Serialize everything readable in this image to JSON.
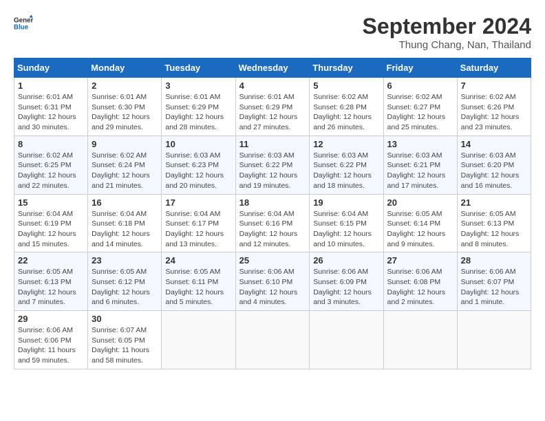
{
  "header": {
    "logo_line1": "General",
    "logo_line2": "Blue",
    "month": "September 2024",
    "location": "Thung Chang, Nan, Thailand"
  },
  "weekdays": [
    "Sunday",
    "Monday",
    "Tuesday",
    "Wednesday",
    "Thursday",
    "Friday",
    "Saturday"
  ],
  "weeks": [
    [
      {
        "day": "1",
        "sunrise": "6:01 AM",
        "sunset": "6:31 PM",
        "daylight": "12 hours and 30 minutes."
      },
      {
        "day": "2",
        "sunrise": "6:01 AM",
        "sunset": "6:30 PM",
        "daylight": "12 hours and 29 minutes."
      },
      {
        "day": "3",
        "sunrise": "6:01 AM",
        "sunset": "6:29 PM",
        "daylight": "12 hours and 28 minutes."
      },
      {
        "day": "4",
        "sunrise": "6:01 AM",
        "sunset": "6:29 PM",
        "daylight": "12 hours and 27 minutes."
      },
      {
        "day": "5",
        "sunrise": "6:02 AM",
        "sunset": "6:28 PM",
        "daylight": "12 hours and 26 minutes."
      },
      {
        "day": "6",
        "sunrise": "6:02 AM",
        "sunset": "6:27 PM",
        "daylight": "12 hours and 25 minutes."
      },
      {
        "day": "7",
        "sunrise": "6:02 AM",
        "sunset": "6:26 PM",
        "daylight": "12 hours and 23 minutes."
      }
    ],
    [
      {
        "day": "8",
        "sunrise": "6:02 AM",
        "sunset": "6:25 PM",
        "daylight": "12 hours and 22 minutes."
      },
      {
        "day": "9",
        "sunrise": "6:02 AM",
        "sunset": "6:24 PM",
        "daylight": "12 hours and 21 minutes."
      },
      {
        "day": "10",
        "sunrise": "6:03 AM",
        "sunset": "6:23 PM",
        "daylight": "12 hours and 20 minutes."
      },
      {
        "day": "11",
        "sunrise": "6:03 AM",
        "sunset": "6:22 PM",
        "daylight": "12 hours and 19 minutes."
      },
      {
        "day": "12",
        "sunrise": "6:03 AM",
        "sunset": "6:22 PM",
        "daylight": "12 hours and 18 minutes."
      },
      {
        "day": "13",
        "sunrise": "6:03 AM",
        "sunset": "6:21 PM",
        "daylight": "12 hours and 17 minutes."
      },
      {
        "day": "14",
        "sunrise": "6:03 AM",
        "sunset": "6:20 PM",
        "daylight": "12 hours and 16 minutes."
      }
    ],
    [
      {
        "day": "15",
        "sunrise": "6:04 AM",
        "sunset": "6:19 PM",
        "daylight": "12 hours and 15 minutes."
      },
      {
        "day": "16",
        "sunrise": "6:04 AM",
        "sunset": "6:18 PM",
        "daylight": "12 hours and 14 minutes."
      },
      {
        "day": "17",
        "sunrise": "6:04 AM",
        "sunset": "6:17 PM",
        "daylight": "12 hours and 13 minutes."
      },
      {
        "day": "18",
        "sunrise": "6:04 AM",
        "sunset": "6:16 PM",
        "daylight": "12 hours and 12 minutes."
      },
      {
        "day": "19",
        "sunrise": "6:04 AM",
        "sunset": "6:15 PM",
        "daylight": "12 hours and 10 minutes."
      },
      {
        "day": "20",
        "sunrise": "6:05 AM",
        "sunset": "6:14 PM",
        "daylight": "12 hours and 9 minutes."
      },
      {
        "day": "21",
        "sunrise": "6:05 AM",
        "sunset": "6:13 PM",
        "daylight": "12 hours and 8 minutes."
      }
    ],
    [
      {
        "day": "22",
        "sunrise": "6:05 AM",
        "sunset": "6:13 PM",
        "daylight": "12 hours and 7 minutes."
      },
      {
        "day": "23",
        "sunrise": "6:05 AM",
        "sunset": "6:12 PM",
        "daylight": "12 hours and 6 minutes."
      },
      {
        "day": "24",
        "sunrise": "6:05 AM",
        "sunset": "6:11 PM",
        "daylight": "12 hours and 5 minutes."
      },
      {
        "day": "25",
        "sunrise": "6:06 AM",
        "sunset": "6:10 PM",
        "daylight": "12 hours and 4 minutes."
      },
      {
        "day": "26",
        "sunrise": "6:06 AM",
        "sunset": "6:09 PM",
        "daylight": "12 hours and 3 minutes."
      },
      {
        "day": "27",
        "sunrise": "6:06 AM",
        "sunset": "6:08 PM",
        "daylight": "12 hours and 2 minutes."
      },
      {
        "day": "28",
        "sunrise": "6:06 AM",
        "sunset": "6:07 PM",
        "daylight": "12 hours and 1 minute."
      }
    ],
    [
      {
        "day": "29",
        "sunrise": "6:06 AM",
        "sunset": "6:06 PM",
        "daylight": "11 hours and 59 minutes."
      },
      {
        "day": "30",
        "sunrise": "6:07 AM",
        "sunset": "6:05 PM",
        "daylight": "11 hours and 58 minutes."
      },
      null,
      null,
      null,
      null,
      null
    ]
  ]
}
